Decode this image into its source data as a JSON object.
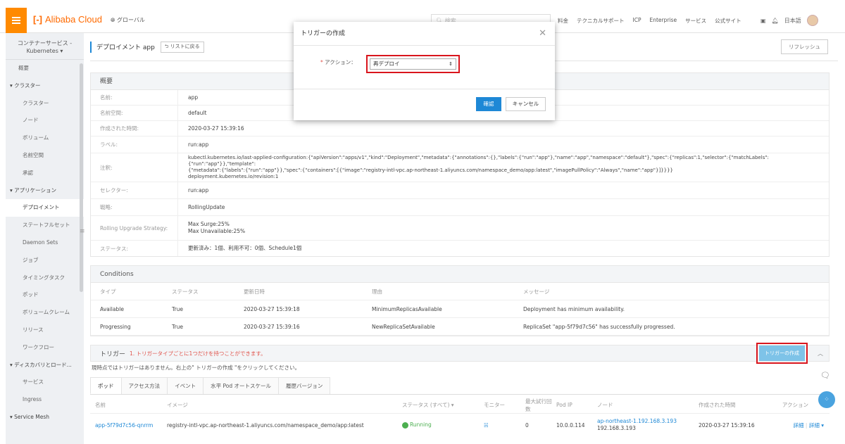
{
  "topbar": {
    "logo": "Alibaba Cloud",
    "global": "グローバル",
    "search_placeholder": "検索",
    "nav": [
      "料金",
      "テクニカルサポート",
      "ICP",
      "Enterprise",
      "サービス",
      "公式サイト"
    ],
    "language": "日本語"
  },
  "sidebar": {
    "head_line1": "コンテナーサービス -",
    "head_line2": "Kubernetes ▾",
    "items": [
      {
        "label": "概要",
        "kind": "top"
      },
      {
        "label": "▾ クラスター",
        "kind": "group"
      },
      {
        "label": "クラスター",
        "kind": "sub"
      },
      {
        "label": "ノード",
        "kind": "sub"
      },
      {
        "label": "ボリューム",
        "kind": "sub"
      },
      {
        "label": "名前空間",
        "kind": "sub"
      },
      {
        "label": "承認",
        "kind": "sub"
      },
      {
        "label": "▾ アプリケーション",
        "kind": "group"
      },
      {
        "label": "デプロイメント",
        "kind": "sub-active"
      },
      {
        "label": "ステートフルセット",
        "kind": "sub"
      },
      {
        "label": "Daemon Sets",
        "kind": "sub"
      },
      {
        "label": "ジョブ",
        "kind": "sub"
      },
      {
        "label": "タイミングタスク",
        "kind": "sub"
      },
      {
        "label": "ポッド",
        "kind": "sub"
      },
      {
        "label": "ボリュームクレーム",
        "kind": "sub"
      },
      {
        "label": "リリース",
        "kind": "sub"
      },
      {
        "label": "ワークフロー",
        "kind": "sub"
      },
      {
        "label": "▾ ディスカバリとロード...",
        "kind": "group"
      },
      {
        "label": "サービス",
        "kind": "sub"
      },
      {
        "label": "Ingress",
        "kind": "sub"
      },
      {
        "label": "▾ Service Mesh",
        "kind": "group"
      }
    ]
  },
  "page": {
    "title": "デプロイメント app",
    "back": "⮌ リストに戻る",
    "refresh": "リフレッシュ"
  },
  "overview": {
    "title": "概要",
    "rows": [
      {
        "k": "名前:",
        "v": "app"
      },
      {
        "k": "名前空間:",
        "v": "default"
      },
      {
        "k": "作成された時間:",
        "v": "2020-03-27 15:39:16"
      },
      {
        "k": "ラベル:",
        "v": "run:app"
      },
      {
        "k": "注釈:",
        "v": "kubectl.kubernetes.io/last-applied-configuration:{\"apiVersion\":\"apps/v1\",\"kind\":\"Deployment\",\"metadata\":{\"annotations\":{},\"labels\":{\"run\":\"app\"},\"name\":\"app\",\"namespace\":\"default\"},\"spec\":{\"replicas\":1,\"selector\":{\"matchLabels\":{\"run\":\"app\"}},\"template\":",
        "v2": "{\"metadata\":{\"labels\":{\"run\":\"app\"}},\"spec\":{\"containers\":[{\"image\":\"registry-intl-vpc.ap-northeast-1.aliyuncs.com/namespace_demo/app:latest\",\"imagePullPolicy\":\"Always\",\"name\":\"app\"}]}}}}",
        "v3": "deployment.kubernetes.io/revision:1"
      },
      {
        "k": "セレクター:",
        "v": "run:app"
      },
      {
        "k": "戦略:",
        "v": "RollingUpdate"
      },
      {
        "k": "Rolling Upgrade Strategy:",
        "v": "Max Surge:25%",
        "v2": "Max Unavailable:25%"
      },
      {
        "k": "ステータス:",
        "v": "更新済み：1個、利用不可：0個、Schedule1個"
      }
    ]
  },
  "conditions": {
    "title": "Conditions",
    "headers": [
      "タイプ",
      "ステータス",
      "更新日時",
      "理由",
      "メッセージ"
    ],
    "rows": [
      [
        "Available",
        "True",
        "2020-03-27 15:39:18",
        "MinimumReplicasAvailable",
        "Deployment has minimum availability."
      ],
      [
        "Progressing",
        "True",
        "2020-03-27 15:39:16",
        "NewReplicaSetAvailable",
        "ReplicaSet \"app-5f79d7c56\" has successfully progressed."
      ]
    ]
  },
  "trigger": {
    "title": "トリガー",
    "note": "1. トリガータイプごとに1つだけを持つことができます。",
    "create_button": "トリガーの作成",
    "empty_message": "現時点ではトリガーはありません。右上の\" トリガーの作成 \"をクリックしてください。"
  },
  "tabs": [
    "ポッド",
    "アクセス方法",
    "イベント",
    "水平 Pod オートスケール",
    "履歴バージョン"
  ],
  "pods": {
    "headers": [
      "名前",
      "イメージ",
      "ステータス (すべて) ▾",
      "モニター",
      "最大試行回数",
      "Pod IP",
      "ノード",
      "作成された時間",
      "アクション"
    ],
    "row": {
      "name": "app-5f79d7c56-qnrrm",
      "image": "registry-intl-vpc.ap-northeast-1.aliyuncs.com/namespace_demo/app:latest",
      "status": "Running",
      "monitor": "☵",
      "retries": "0",
      "pod_ip": "10.0.0.114",
      "node_link": "ap-northeast-1.192.168.3.193",
      "node_ip": "192.168.3.193",
      "created": "2020-03-27 15:39:16",
      "action_detail": "詳細",
      "action_more": "詳細 ▾"
    }
  },
  "dialog": {
    "title": "トリガーの作成",
    "close": "✕",
    "required_mark": "*",
    "action_label": "アクション：",
    "action_value": "再デプロイ",
    "ok": "確認",
    "cancel": "キャンセル"
  },
  "colors": {
    "accent": "#1e88d6",
    "brand": "#ff6a00",
    "highlight": "#d9151d"
  }
}
